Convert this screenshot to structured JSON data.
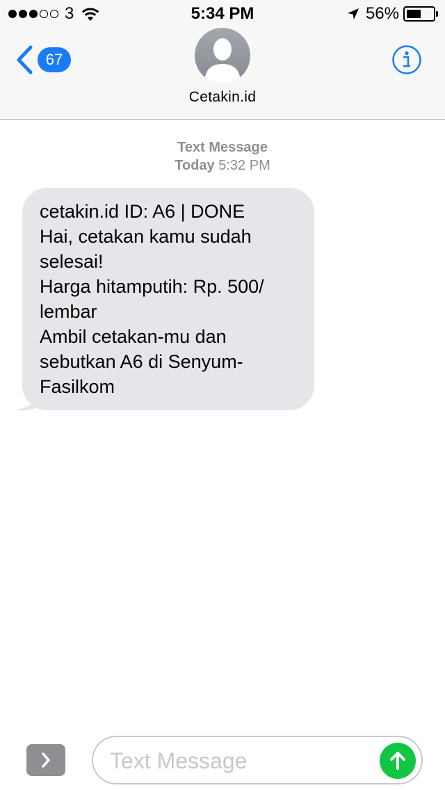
{
  "status_bar": {
    "signal_dots_filled": 3,
    "signal_dots_total": 5,
    "carrier": "3",
    "time": "5:34 PM",
    "battery_percent": "56%",
    "battery_level": 0.56
  },
  "header": {
    "unread_count": "67",
    "contact_name": "Cetakin.id",
    "accent_color": "#1a7cf5"
  },
  "conversation": {
    "meta_type": "Text Message",
    "meta_day": "Today",
    "meta_time": "5:32 PM",
    "message_lines": [
      "cetakin.id ID: A6 | DONE",
      "Hai, cetakan kamu sudah",
      "selesai!",
      "Harga hitamputih: Rp. 500/",
      "lembar",
      "Ambil cetakan-mu dan",
      "sebutkan A6 di Senyum-",
      "Fasilkom"
    ],
    "bubble_color": "#e5e5ea"
  },
  "input_bar": {
    "placeholder": "Text Message",
    "value": "",
    "send_color": "#12c644"
  },
  "icons": {
    "wifi": "wifi-icon",
    "location": "location-arrow-icon",
    "back": "chevron-left-icon",
    "info": "info-icon",
    "expand": "chevron-right-icon",
    "send": "arrow-up-icon",
    "avatar": "person-silhouette-icon"
  }
}
